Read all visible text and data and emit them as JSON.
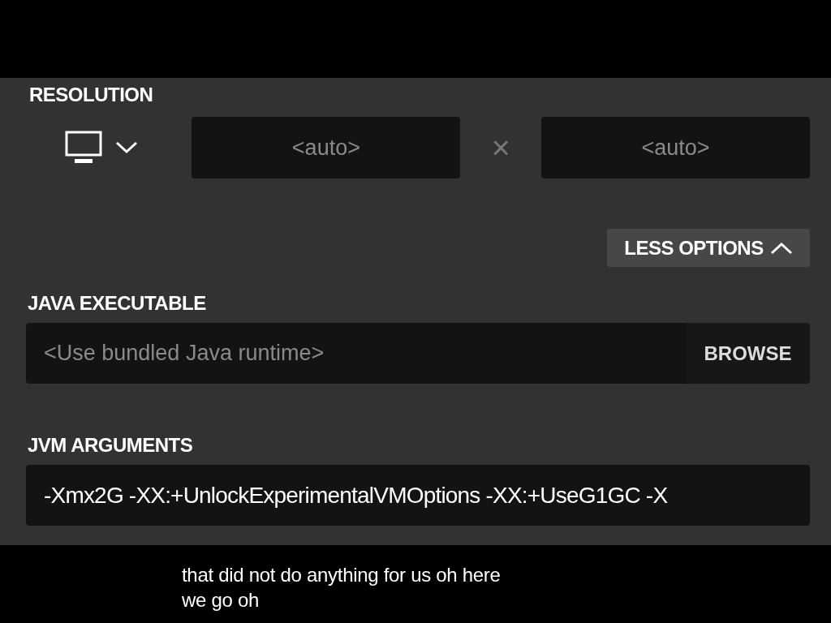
{
  "resolution": {
    "label": "RESOLUTION",
    "width": {
      "placeholder": "<auto>"
    },
    "separator": "×",
    "height": {
      "placeholder": "<auto>"
    }
  },
  "options_toggle": {
    "label": "LESS OPTIONS",
    "expanded": true
  },
  "java_executable": {
    "label": "JAVA EXECUTABLE",
    "placeholder": "<Use bundled Java runtime>",
    "button": "BROWSE"
  },
  "jvm_arguments": {
    "label": "JVM ARGUMENTS",
    "value": "-Xmx2G -XX:+UnlockExperimentalVMOptions -XX:+UseG1GC -X"
  },
  "subtitle": [
    "that did not do anything for us oh here",
    "we go oh"
  ]
}
